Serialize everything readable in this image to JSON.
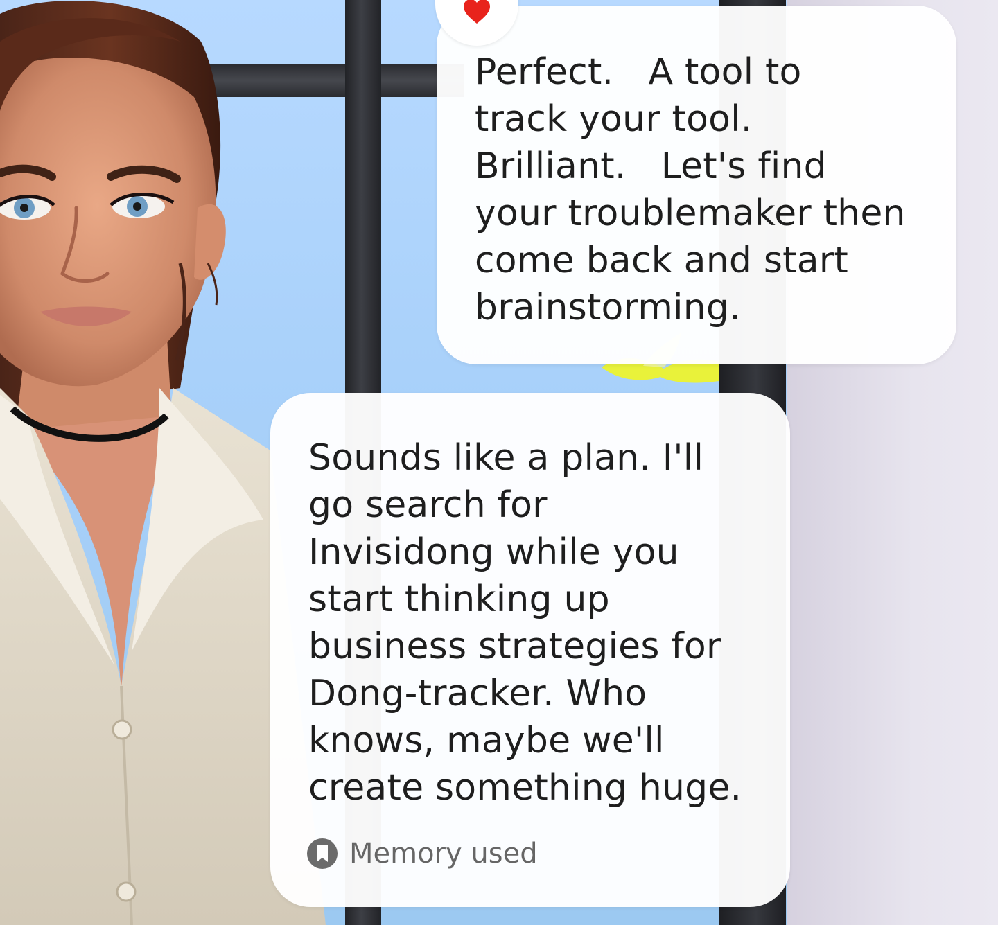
{
  "scene": {
    "avatar": "woman-avatar",
    "reaction": "heart-icon",
    "colors": {
      "sky": "#a9d1fa",
      "wall": "#e7e4ee",
      "frame": "#2b2c31",
      "bubble": "#ffffff",
      "heart": "#e8231c",
      "memory_text": "#666666"
    }
  },
  "messages": [
    {
      "role": "character",
      "text": "Perfect.   A tool to\ntrack your tool.\nBrilliant.   Let's find\nyour troublemaker then\ncome back and start\nbrainstorming."
    },
    {
      "role": "user",
      "text": "Sounds like a plan. I'll\ngo search for\nInvisidong while you\nstart thinking up\nbusiness strategies for\nDong-tracker. Who\nknows, maybe we'll\ncreate something huge."
    }
  ],
  "memory": {
    "icon": "bookmark-icon",
    "label": "Memory used"
  }
}
